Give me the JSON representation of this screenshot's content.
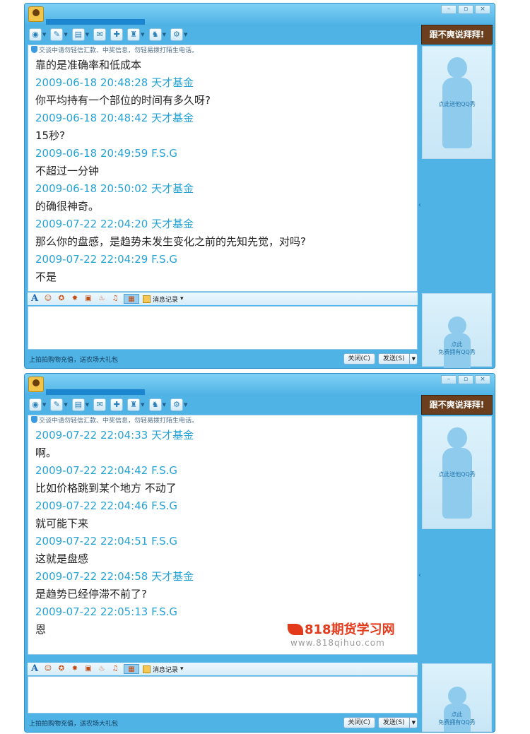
{
  "window1": {
    "window_buttons": [
      "–",
      "▫",
      "×"
    ],
    "banner": "跟不爽说拜拜!",
    "notice": "交谈中请勿轻信汇款、中奖信息，勿轻易拨打陌生电话。",
    "show_text": "点此送他QQ秀",
    "show2_line1": "点此",
    "show2_line2": "免费拥有QQ秀",
    "history": "消息记录",
    "promo": "上拍拍购物充值，送农场大礼包",
    "close": "关闭(C)",
    "send": "发送(S)",
    "messages": [
      {
        "text": "靠的是准确率和低成本"
      },
      {
        "meta": "2009-06-18 20:48:28 天才基金",
        "text": "你平均持有一个部位的时间有多久呀?"
      },
      {
        "meta": "2009-06-18 20:48:42 天才基金",
        "text": "15秒?"
      },
      {
        "meta": "2009-06-18 20:49:59 F.S.G",
        "text": "不超过一分钟"
      },
      {
        "meta": "2009-06-18 20:50:02 天才基金",
        "text": "的确很神奇。"
      },
      {
        "meta": "2009-07-22 22:04:20 天才基金",
        "text": "那么你的盘感，是趋势未发生变化之前的先知先觉，对吗?"
      },
      {
        "meta": "2009-07-22 22:04:29 F.S.G",
        "text": "不是"
      }
    ]
  },
  "window2": {
    "window_buttons": [
      "–",
      "▫",
      "×"
    ],
    "banner": "跟不爽说拜拜!",
    "notice": "交谈中请勿轻信汇款、中奖信息，勿轻易拨打陌生电话。",
    "show_text": "点此送他QQ秀",
    "show2_line1": "点此",
    "show2_line2": "免费拥有QQ秀",
    "history": "消息记录",
    "promo": "上拍拍购物充值，送农场大礼包",
    "close": "关闭(C)",
    "send": "发送(S)",
    "messages": [
      {
        "meta": "2009-07-22 22:04:33 天才基金",
        "text": "啊。"
      },
      {
        "meta": "2009-07-22 22:04:42 F.S.G",
        "text": "比如价格跳到某个地方 不动了"
      },
      {
        "meta": "2009-07-22 22:04:46 F.S.G",
        "text": "就可能下来"
      },
      {
        "meta": "2009-07-22 22:04:51 F.S.G",
        "text": "这就是盘感"
      },
      {
        "meta": "2009-07-22 22:04:58 天才基金",
        "text": "是趋势已经停滞不前了?"
      },
      {
        "meta": "2009-07-22 22:05:13 F.S.G",
        "text": "恩"
      }
    ],
    "watermark_title": "818期货学习网",
    "watermark_url": "www.818qihuo.com"
  },
  "colors": {
    "accent": "#4fb3e6",
    "meta_text": "#26a3d6",
    "banner": "#6b3f1d",
    "watermark": "#e23a1a"
  },
  "icons": [
    "qq-avatar-icon",
    "video-icon",
    "voice-icon",
    "file-transfer-icon",
    "sms-icon",
    "app-icon",
    "group-icon",
    "remote-icon",
    "settings-icon"
  ]
}
